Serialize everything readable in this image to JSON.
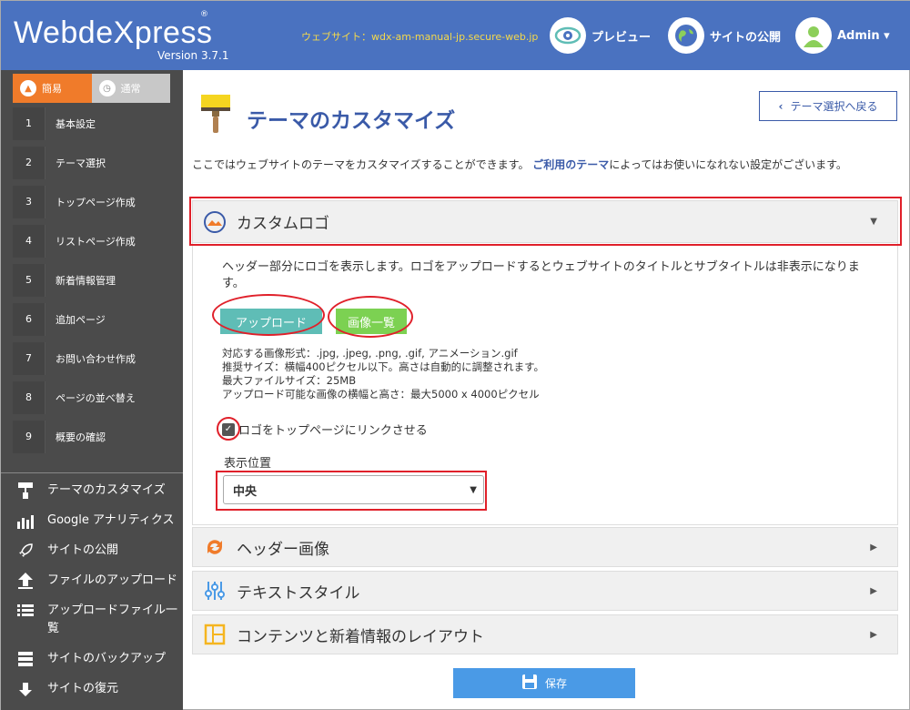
{
  "header": {
    "logo_left": "Webde",
    "logo_x": "X",
    "logo_right": "press",
    "logo_mark": "®",
    "version": "Version 3.7.1",
    "website": "ウェブサイト：wdx-am-manual-jp.secure-web.jp",
    "preview_label": "プレビュー",
    "publish_label": "サイトの公開",
    "admin_label": "Admin ▾"
  },
  "sidebar": {
    "mode_simple": "簡易",
    "mode_normal": "通常",
    "steps": [
      {
        "num": "1",
        "label": "基本設定"
      },
      {
        "num": "2",
        "label": "テーマ選択"
      },
      {
        "num": "3",
        "label": "トップページ作成"
      },
      {
        "num": "4",
        "label": "リストページ作成"
      },
      {
        "num": "5",
        "label": "新着情報管理"
      },
      {
        "num": "6",
        "label": "追加ページ"
      },
      {
        "num": "7",
        "label": "お問い合わせ作成"
      },
      {
        "num": "8",
        "label": "ページの並べ替え"
      },
      {
        "num": "9",
        "label": "概要の確認"
      }
    ],
    "tools": [
      {
        "label": "テーマのカスタマイズ"
      },
      {
        "label": "Google アナリティクス"
      },
      {
        "label": "サイトの公開"
      },
      {
        "label": "ファイルのアップロード"
      },
      {
        "label": "アップロードファイル一覧"
      },
      {
        "label": "サイトのバックアップ"
      },
      {
        "label": "サイトの復元"
      }
    ]
  },
  "main": {
    "title": "テーマのカスタマイズ",
    "back_button": "テーマ選択へ戻る",
    "intro_before": "ここではウェブサイトのテーマをカスタマイズすることができます。",
    "intro_link": "ご利用のテーマ",
    "intro_after": "によってはお使いになれない設定がございます。",
    "logo_panel": {
      "title": "カスタムロゴ",
      "description": "ヘッダー部分にロゴを表示します。ロゴをアップロードするとウェブサイトのタイトルとサブタイトルは非表示になります。",
      "upload_button": "アップロード",
      "list_button": "画像一覧",
      "specs": [
        "対応する画像形式：.jpg, .jpeg, .png, .gif, アニメーション.gif",
        "推奨サイズ：横幅400ピクセル以下。高さは自動的に調整されます。",
        "最大ファイルサイズ：25MB",
        "アップロード可能な画像の横幅と高さ：最大5000 x 4000ピクセル"
      ],
      "link_checkbox_label": "ロゴをトップページにリンクさせる",
      "position_label": "表示位置",
      "position_value": "中央"
    },
    "header_image_panel": "ヘッダー画像",
    "text_style_panel": "テキストスタイル",
    "layout_panel": "コンテンツと新着情報のレイアウト",
    "save_button": "保存"
  },
  "colors": {
    "header_bg": "#4a72c0",
    "sidebar_bg": "#4b4b4b",
    "accent_orange": "#f07b2a",
    "title_blue": "#3a5aa8",
    "upload_teal": "#5fbdb6",
    "list_green": "#7cd152",
    "save_blue": "#4a9ae6",
    "highlight_red": "#e0202a"
  }
}
